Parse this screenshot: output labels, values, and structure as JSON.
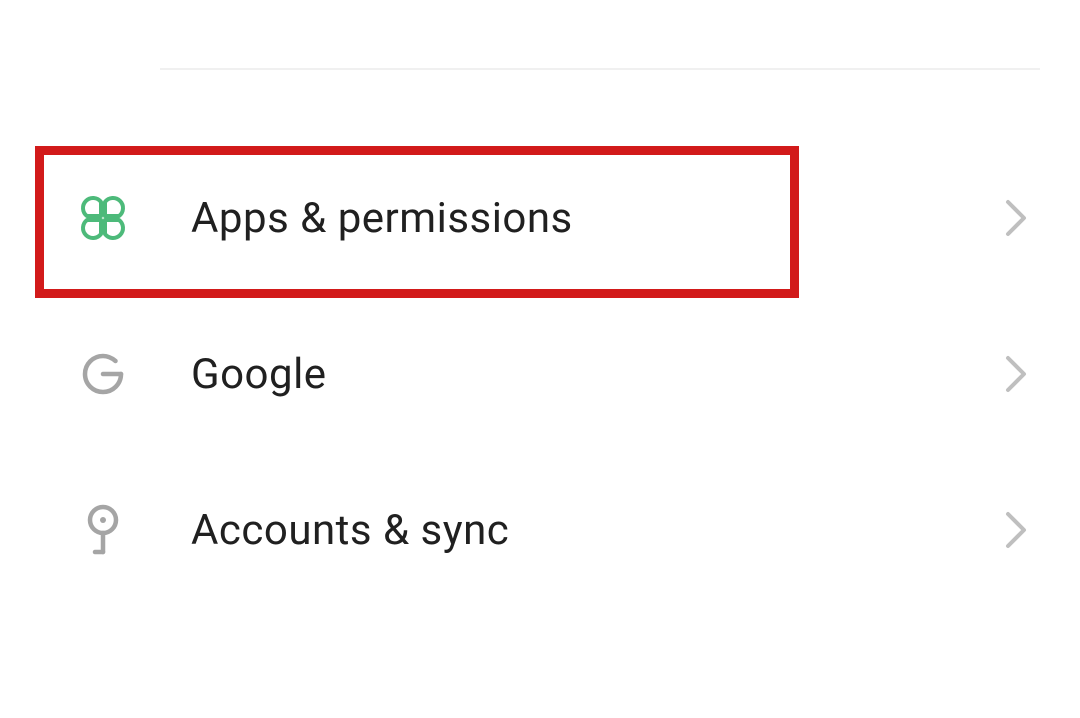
{
  "items": [
    {
      "label": "Apps & permissions",
      "highlighted": true
    },
    {
      "label": "Google",
      "highlighted": false
    },
    {
      "label": "Accounts & sync",
      "highlighted": false
    }
  ],
  "colors": {
    "accent_green": "#4DBA7A",
    "gray_icon": "#A5A5A5",
    "chevron": "#BFBFBF",
    "highlight": "#D21A1A"
  }
}
